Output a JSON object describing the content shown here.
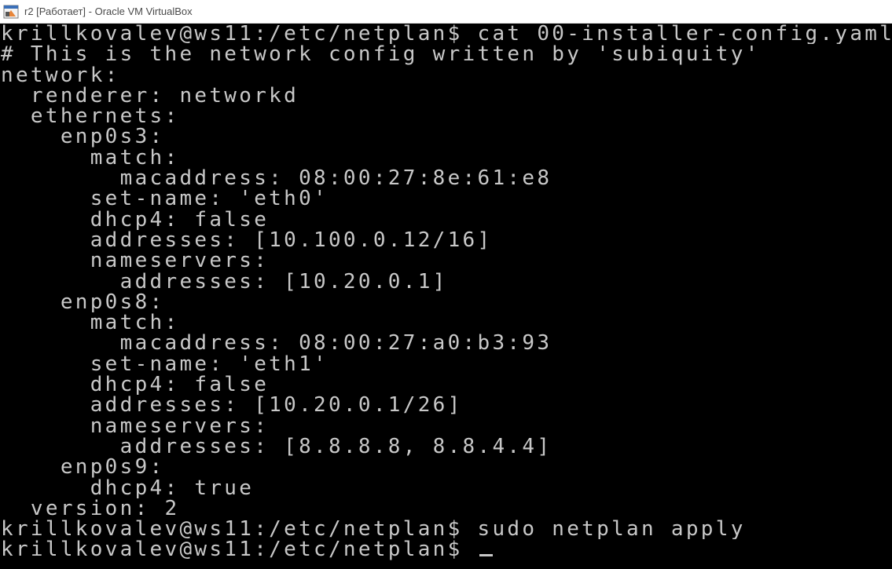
{
  "window": {
    "title": "r2 [Работает] - Oracle VM VirtualBox",
    "icon": "virtualbox-icon"
  },
  "terminal": {
    "lines": [
      "krillkovalev@ws11:/etc/netplan$ cat 00-installer-config.yaml",
      "# This is the network config written by 'subiquity'",
      "network:",
      "  renderer: networkd",
      "  ethernets:",
      "    enp0s3:",
      "      match:",
      "        macaddress: 08:00:27:8e:61:e8",
      "      set-name: 'eth0'",
      "      dhcp4: false",
      "      addresses: [10.100.0.12/16]",
      "      nameservers:",
      "        addresses: [10.20.0.1]",
      "    enp0s8:",
      "      match:",
      "        macaddress: 08:00:27:a0:b3:93",
      "      set-name: 'eth1'",
      "      dhcp4: false",
      "      addresses: [10.20.0.1/26]",
      "      nameservers:",
      "        addresses: [8.8.8.8, 8.8.4.4]",
      "    enp0s9:",
      "      dhcp4: true",
      "  version: 2",
      "krillkovalev@ws11:/etc/netplan$ sudo netplan apply",
      "krillkovalev@ws11:/etc/netplan$ "
    ],
    "fg_color": "#c8c8c8",
    "bg_color": "#000000"
  }
}
